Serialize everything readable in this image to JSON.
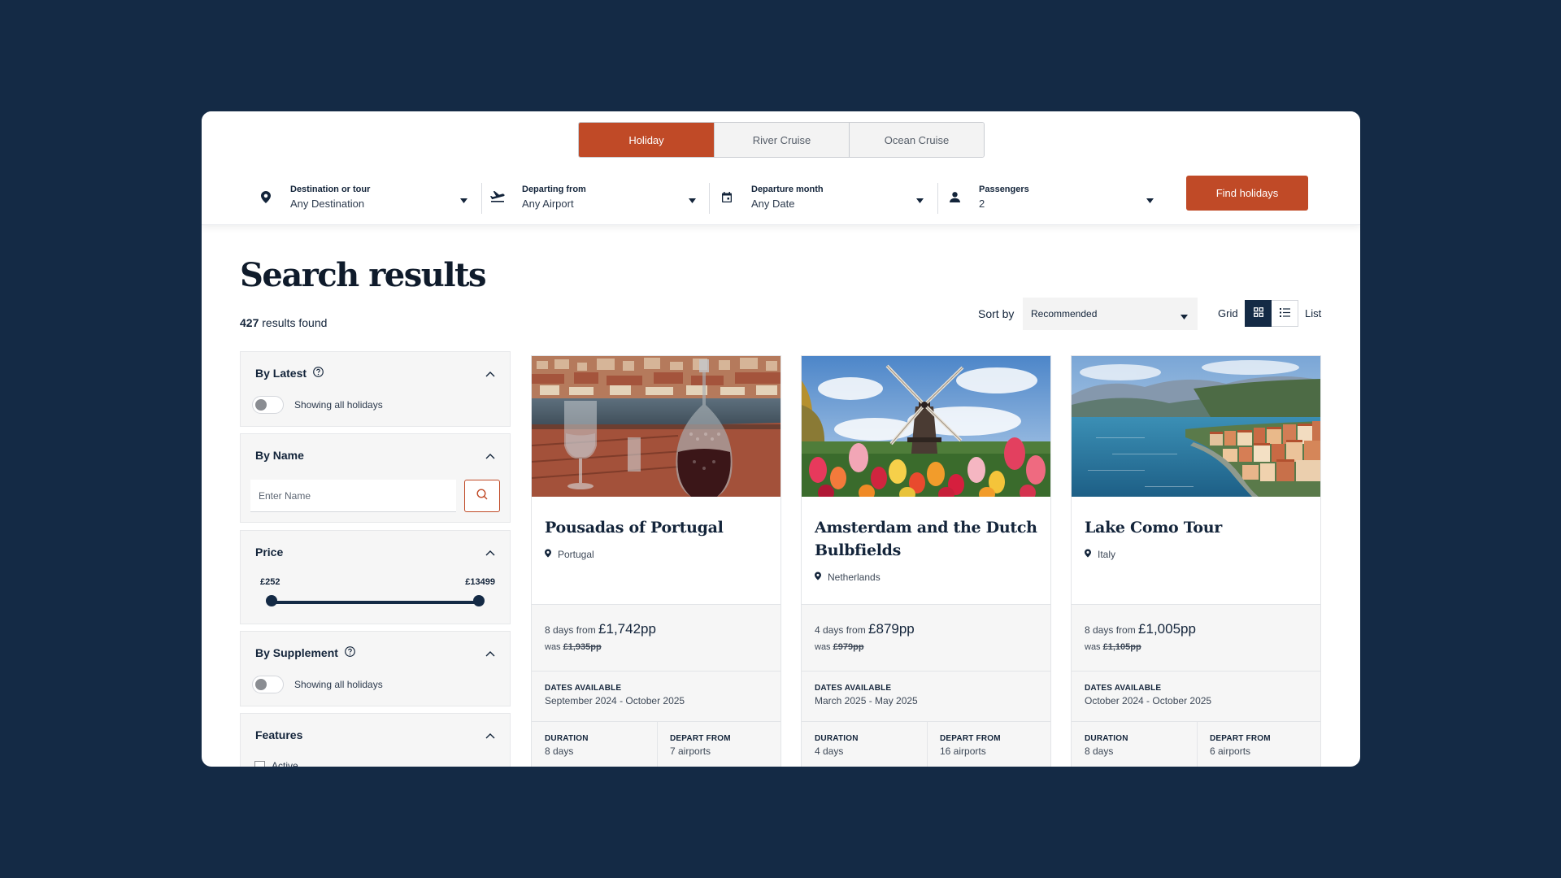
{
  "tabs": [
    {
      "label": "Holiday",
      "active": true
    },
    {
      "label": "River Cruise",
      "active": false
    },
    {
      "label": "Ocean Cruise",
      "active": false
    }
  ],
  "search": {
    "destination": {
      "label": "Destination or tour",
      "value": "Any Destination",
      "icon": "location-pin-icon"
    },
    "departing": {
      "label": "Departing from",
      "value": "Any Airport",
      "icon": "plane-takeoff-icon"
    },
    "month": {
      "label": "Departure month",
      "value": "Any Date",
      "icon": "calendar-icon"
    },
    "passengers": {
      "label": "Passengers",
      "value": "2",
      "icon": "person-icon"
    },
    "button": "Find holidays"
  },
  "results": {
    "title": "Search results",
    "count": "427",
    "count_suffix": " results found",
    "sort_label": "Sort by",
    "sort_value": "Recommended",
    "grid_label": "Grid",
    "list_label": "List"
  },
  "filters": {
    "latest": {
      "title": "By Latest",
      "toggle_text": "Showing all holidays"
    },
    "name": {
      "title": "By Name",
      "placeholder": "Enter Name"
    },
    "price": {
      "title": "Price",
      "min": "£252",
      "max": "£13499",
      "range_min_fraction": 0.0,
      "range_max_fraction": 1.0
    },
    "supplement": {
      "title": "By Supplement",
      "toggle_text": "Showing all holidays"
    },
    "features": {
      "title": "Features",
      "options": [
        "Active"
      ]
    }
  },
  "cards": [
    {
      "title": "Pousadas of Portugal",
      "location": "Portugal",
      "days_prefix": "8 days from ",
      "price": "£1,742pp",
      "was_prefix": "was ",
      "was_price": "£1,935pp",
      "dates_label": "DATES AVAILABLE",
      "dates": "September 2024 - October 2025",
      "duration_label": "DURATION",
      "duration": "8 days",
      "depart_label": "DEPART FROM",
      "depart": "7 airports"
    },
    {
      "title": "Amsterdam and the Dutch Bulbfields",
      "location": "Netherlands",
      "days_prefix": "4 days from ",
      "price": "£879pp",
      "was_prefix": "was ",
      "was_price": "£979pp",
      "dates_label": "DATES AVAILABLE",
      "dates": "March 2025 - May 2025",
      "duration_label": "DURATION",
      "duration": "4 days",
      "depart_label": "DEPART FROM",
      "depart": "16 airports"
    },
    {
      "title": "Lake Como Tour",
      "location": "Italy",
      "days_prefix": "8 days from ",
      "price": "£1,005pp",
      "was_prefix": "was ",
      "was_price": "£1,105pp",
      "dates_label": "DATES AVAILABLE",
      "dates": "October 2024 - October 2025",
      "duration_label": "DURATION",
      "duration": "8 days",
      "depart_label": "DEPART FROM",
      "depart": "6 airports"
    }
  ],
  "colors": {
    "background": "#142a45",
    "accent": "#c04a27",
    "navy": "#142a45",
    "panel": "#f6f6f6"
  }
}
